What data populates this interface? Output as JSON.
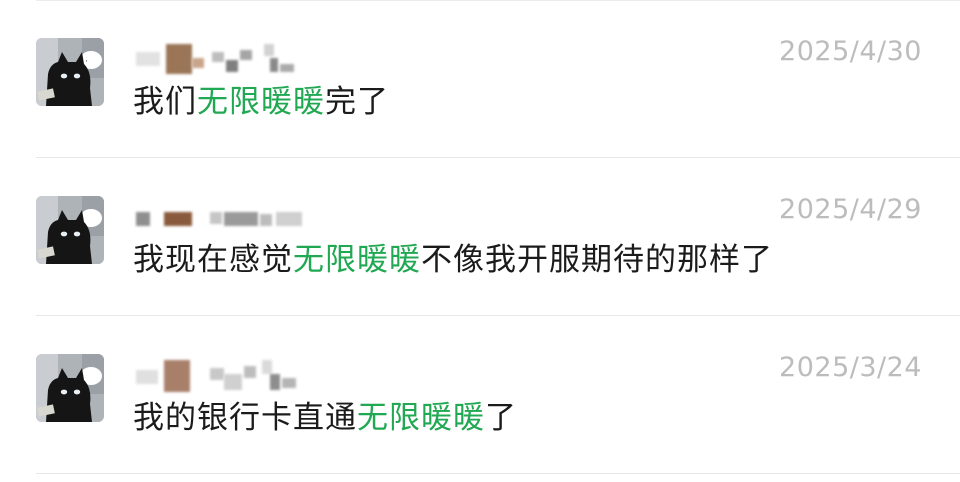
{
  "colors": {
    "highlight": "#21a852",
    "text": "#1b1b1b",
    "date": "#bcbcbc"
  },
  "results": [
    {
      "date": "2025/4/30",
      "message": {
        "before": "我们",
        "keyword": "无限暖暖",
        "after": "完了"
      }
    },
    {
      "date": "2025/4/29",
      "message": {
        "before": "我现在感觉",
        "keyword": "无限暖暖",
        "after": "不像我开服期待的那样了"
      }
    },
    {
      "date": "2025/3/24",
      "message": {
        "before": "我的银行卡直通",
        "keyword": "无限暖暖",
        "after": "了"
      }
    }
  ]
}
